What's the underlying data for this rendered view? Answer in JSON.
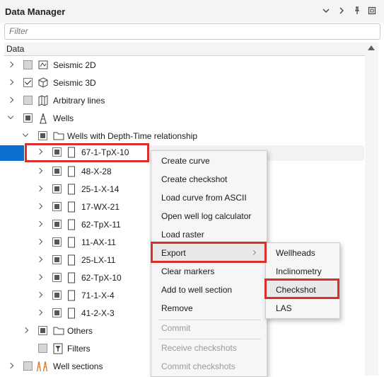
{
  "panel": {
    "title": "Data Manager",
    "controls": [
      "chevron-down-icon",
      "chevron-right-icon",
      "pin-icon",
      "maximize-icon"
    ]
  },
  "filter": {
    "placeholder": "Filter",
    "value": ""
  },
  "tree": {
    "header": "Data",
    "items": [
      {
        "label": "Seismic 2D"
      },
      {
        "label": "Seismic 3D"
      },
      {
        "label": "Arbitrary lines"
      },
      {
        "label": "Wells"
      },
      {
        "label": "Wells with Depth-Time relationship"
      },
      {
        "label": "67-1-TpX-10"
      },
      {
        "label": "48-X-28"
      },
      {
        "label": "25-1-X-14"
      },
      {
        "label": "17-WX-21"
      },
      {
        "label": "62-TpX-11"
      },
      {
        "label": "11-AX-11"
      },
      {
        "label": "25-LX-11"
      },
      {
        "label": "62-TpX-10"
      },
      {
        "label": "71-1-X-4"
      },
      {
        "label": "41-2-X-3"
      },
      {
        "label": "Others"
      },
      {
        "label": "Filters"
      },
      {
        "label": "Well sections"
      }
    ]
  },
  "context_menu": {
    "items": [
      {
        "label": "Create curve",
        "enabled": true
      },
      {
        "label": "Create checkshot",
        "enabled": true
      },
      {
        "label": "Load curve from ASCII",
        "enabled": true
      },
      {
        "label": "Open well log calculator",
        "enabled": true
      },
      {
        "label": "Load raster",
        "enabled": true
      },
      {
        "label": "Export",
        "enabled": true,
        "submenu": true
      },
      {
        "label": "Clear markers",
        "enabled": true
      },
      {
        "label": "Add to well section",
        "enabled": true
      },
      {
        "label": "Remove",
        "enabled": true
      },
      {
        "label": "Commit",
        "enabled": false
      },
      {
        "label": "Receive checkshots",
        "enabled": false
      },
      {
        "label": "Commit checkshots",
        "enabled": false
      }
    ]
  },
  "export_submenu": {
    "items": [
      {
        "label": "Wellheads"
      },
      {
        "label": "Inclinometry"
      },
      {
        "label": "Checkshot"
      },
      {
        "label": "LAS"
      }
    ]
  },
  "colors": {
    "highlight_box": "#d9302c",
    "selection": "#0a6fce",
    "menu_background": "#f6f6f6"
  }
}
